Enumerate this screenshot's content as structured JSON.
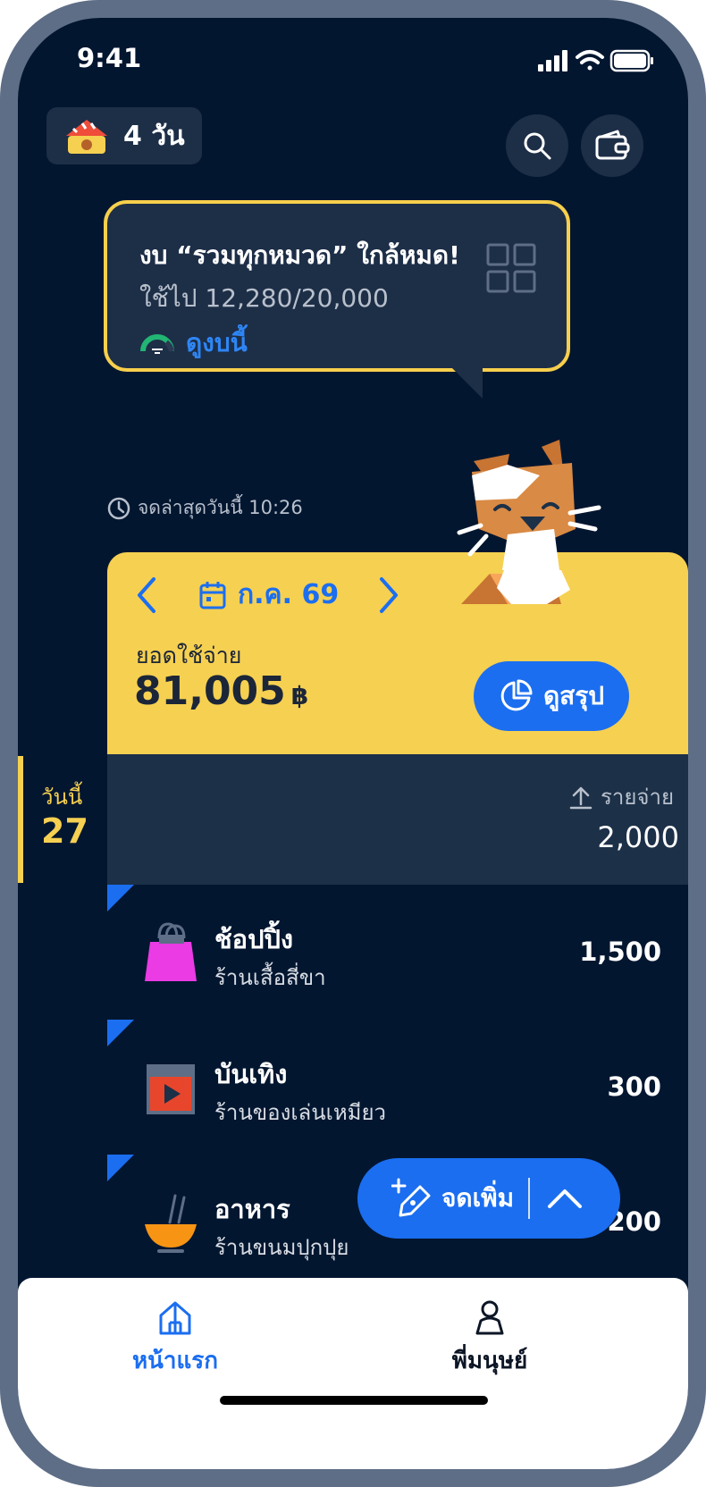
{
  "status_bar": {
    "time": "9:41"
  },
  "header": {
    "streak_label": "4 วัน"
  },
  "budget_alert": {
    "title": "งบ “รวมทุกหมวด” ใกล้หมด!",
    "subtitle": "ใช้ไป 12,280/20,000",
    "link_label": "ดูงบนี้",
    "used": 12280,
    "limit": 20000
  },
  "last_entry": {
    "text": "จดล่าสุดวันนี้ 10:26"
  },
  "summary": {
    "month": "ก.ค. 69",
    "spend_label": "ยอดใช้จ่าย",
    "spend_amount": "81,005",
    "currency": "฿",
    "summary_button": "ดูสรุป"
  },
  "today": {
    "label": "วันนี้",
    "day": "27",
    "expense_label": "รายจ่าย",
    "expense_total": "2,000"
  },
  "transactions": [
    {
      "category": "ช้อปปิ้ง",
      "shop": "ร้านเสื้อสี่ขา",
      "amount": "1,500",
      "icon": "shopping-bag-icon"
    },
    {
      "category": "บันเทิง",
      "shop": "ร้านของเล่นเหมียว",
      "amount": "300",
      "icon": "entertainment-icon"
    },
    {
      "category": "อาหาร",
      "shop": "ร้านขนมปุกปุย",
      "amount": "200",
      "icon": "food-bowl-icon"
    }
  ],
  "fab": {
    "label": "จดเพิ่ม"
  },
  "tabbar": {
    "items": [
      {
        "label": "หน้าแรก",
        "active": true,
        "color": "#1b6ef0"
      },
      {
        "label": "พี่มนุษย์",
        "active": false,
        "color": "#0d1626"
      }
    ]
  },
  "colors": {
    "accent": "#1b6ef0",
    "card": "#f6d051",
    "background": "#031630"
  }
}
